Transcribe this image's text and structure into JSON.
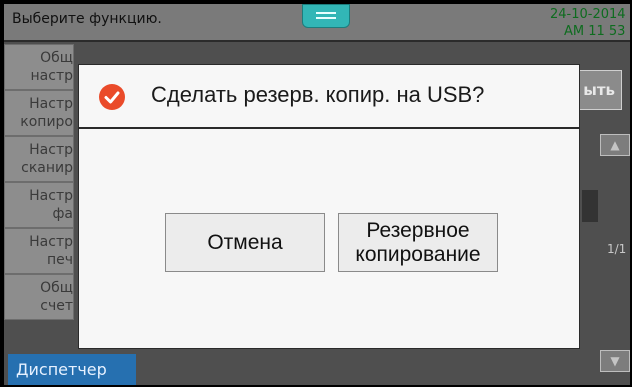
{
  "header": {
    "prompt": "Выберите функцию.",
    "date": "24-10-2014",
    "time": "AM 11 53"
  },
  "left_menu": {
    "items": [
      {
        "line1": "Общ",
        "line2": "настр"
      },
      {
        "line1": "Настр",
        "line2": "копиро"
      },
      {
        "line1": "Настр",
        "line2": "сканир"
      },
      {
        "line1": "Настр",
        "line2": "фа"
      },
      {
        "line1": "Настр",
        "line2": "печ"
      },
      {
        "line1": "Общ",
        "line2": "счет"
      }
    ],
    "dispatcher_label": "Диспетчер"
  },
  "right_panel": {
    "exit_label": "ыть",
    "page_indicator": "1/1"
  },
  "dialog": {
    "icon": "check-circle-icon",
    "icon_color": "#ea4b2a",
    "title": "Сделать резерв. копир. на USB?",
    "cancel_label": "Отмена",
    "backup_label_line1": "Резервное",
    "backup_label_line2": "копирование"
  },
  "colors": {
    "accent_teal": "#32b6b6",
    "clock_green": "#0e6c1f",
    "dispatcher_blue": "#2670b0"
  }
}
